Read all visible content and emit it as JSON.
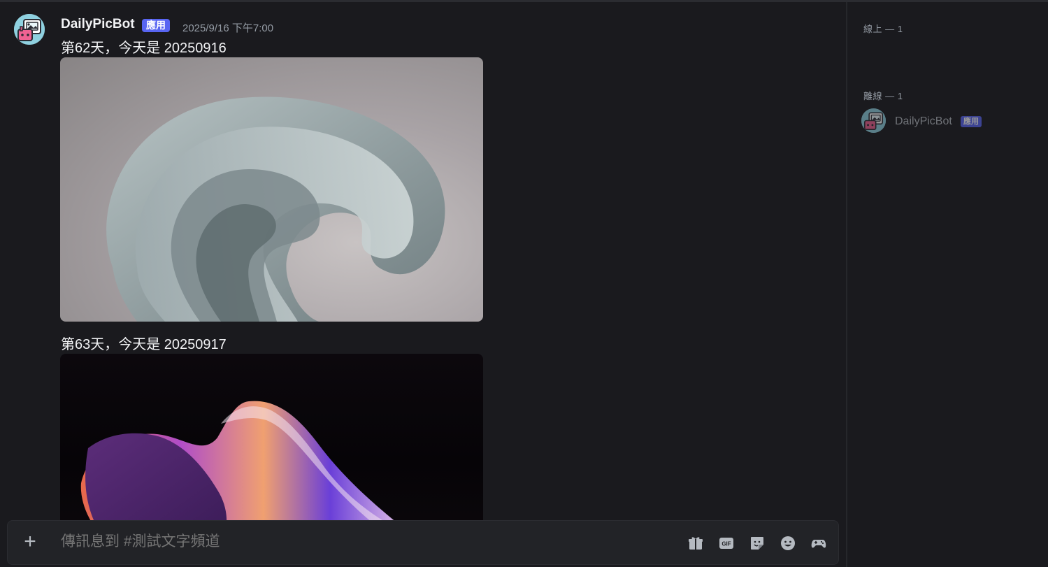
{
  "message": {
    "author": "DailyPicBot",
    "app_tag": "應用",
    "timestamp": "2025/9/16 下午7:00",
    "posts": [
      {
        "text": "第62天，今天是 20250916"
      },
      {
        "text": "第63天，今天是 20250917"
      }
    ]
  },
  "composer": {
    "placeholder": "傳訊息到 #測試文字頻道",
    "plus_label": "+",
    "tools": [
      "gift-icon",
      "gif-icon",
      "sticker-icon",
      "emoji-icon",
      "activity-icon"
    ],
    "gif_text": "GIF"
  },
  "members": {
    "online_header": "線上 — 1",
    "offline_header": "離線 — 1",
    "offline_members": [
      {
        "name": "DailyPicBot",
        "tag": "應用"
      }
    ]
  },
  "colors": {
    "background": "#1a1a1e",
    "accent": "#5865f2",
    "muted_text": "#949ba4",
    "avatar_bg": "#8fd1e0"
  }
}
